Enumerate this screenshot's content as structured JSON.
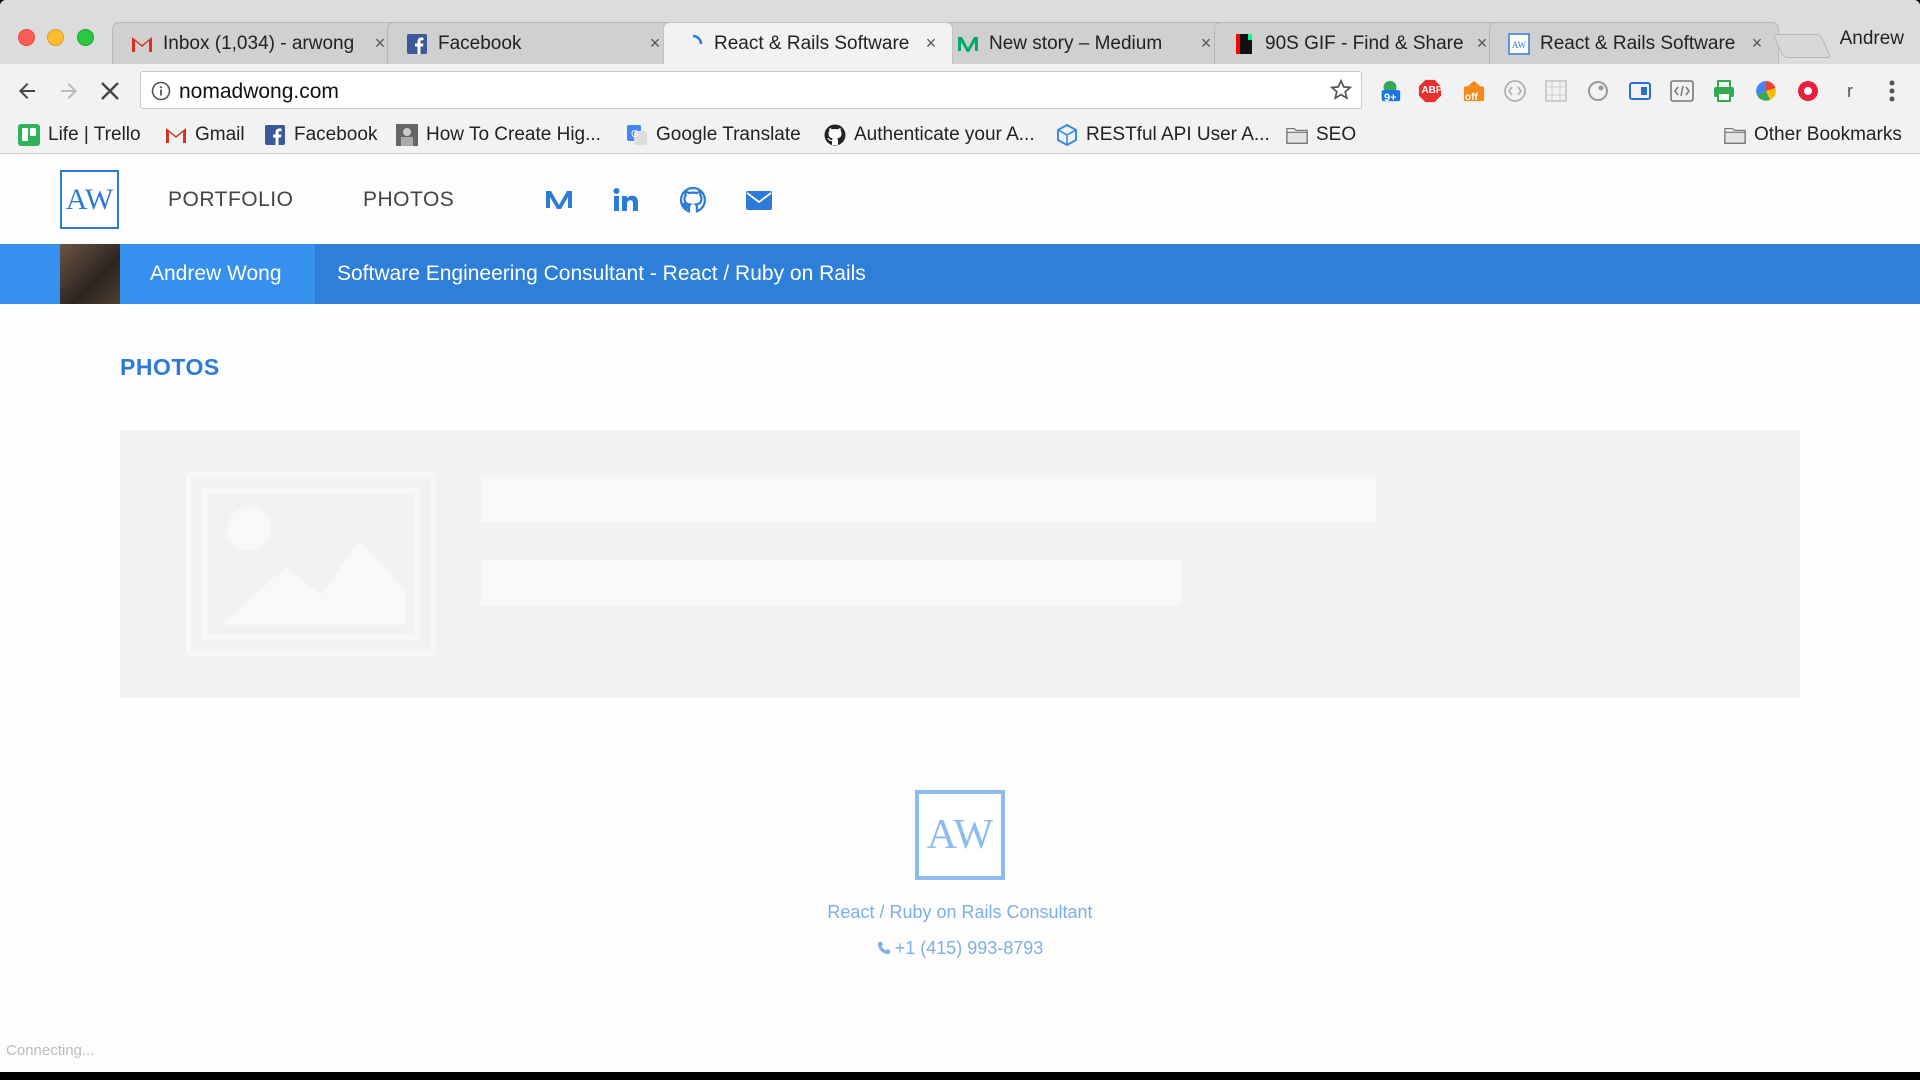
{
  "browser": {
    "tabs": [
      {
        "title": "Inbox (1,034) - arwong",
        "icon": "gmail-icon"
      },
      {
        "title": "Facebook",
        "icon": "facebook-icon"
      },
      {
        "title": "React & Rails Software",
        "icon": "loading-spinner-icon",
        "active": true
      },
      {
        "title": "New story – Medium",
        "icon": "medium-icon"
      },
      {
        "title": "90S GIF - Find & Share",
        "icon": "giphy-icon"
      },
      {
        "title": "React & Rails Software",
        "icon": "aw-site-icon"
      }
    ],
    "close_glyph": "×",
    "profile_name": "Andrew",
    "url": "nomadwong.com",
    "extension_badges": {
      "counter": "9+",
      "abp": "ABP",
      "off": "off",
      "letter": "r"
    },
    "bookmarks": [
      {
        "label": "Life | Trello",
        "icon": "trello-icon"
      },
      {
        "label": "Gmail",
        "icon": "gmail-icon"
      },
      {
        "label": "Facebook",
        "icon": "facebook-icon"
      },
      {
        "label": "How To Create Hig...",
        "icon": "page-thumbnail-icon"
      },
      {
        "label": "Google Translate",
        "icon": "google-translate-icon"
      },
      {
        "label": "Authenticate your A...",
        "icon": "github-icon"
      },
      {
        "label": "RESTful API User A...",
        "icon": "cube-icon"
      },
      {
        "label": "SEO",
        "icon": "folder-icon"
      },
      {
        "label": "Other Bookmarks",
        "icon": "folder-icon"
      }
    ],
    "status_text": "Connecting..."
  },
  "site": {
    "logo_text": "AW",
    "nav": {
      "portfolio": "PORTFOLIO",
      "photos": "PHOTOS"
    },
    "social_icons": [
      "medium-icon",
      "linkedin-icon",
      "github-icon",
      "email-icon"
    ],
    "banner": {
      "name": "Andrew Wong",
      "tagline": "Software Engineering Consultant - React / Ruby on Rails"
    },
    "section_title": "PHOTOS",
    "footer": {
      "logo_text": "AW",
      "subtitle": "React / Ruby on Rails Consultant",
      "phone": "+1 (415) 993-8793",
      "phone_icon": "phone-icon"
    }
  },
  "colors": {
    "accent": "#2d7bd9",
    "banner": "#2e7fd9",
    "banner_name_bg": "#3590ee",
    "footer_accent": "#7daee8"
  }
}
